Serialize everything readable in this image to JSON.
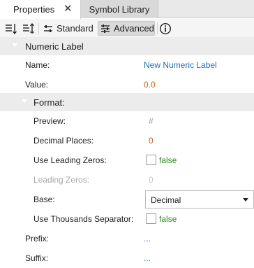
{
  "tabs": [
    {
      "label": "Properties",
      "close": "✕"
    },
    {
      "label": "Symbol Library"
    }
  ],
  "toolbar": {
    "sort_icon": "sort-descending-icon",
    "filter_icon": "sort-ascending-icon",
    "standard_label": "Standard",
    "advanced_label": "Advanced",
    "info_icon": "info-icon"
  },
  "section": {
    "title": "Numeric Label",
    "name_label": "Name:",
    "name_value": "New Numeric Label",
    "value_label": "Value:",
    "value_value": "0.0"
  },
  "format": {
    "title": "Format:",
    "preview_label": "Preview:",
    "preview_value": "#",
    "decimal_label": "Decimal Places:",
    "decimal_value": "0",
    "leading_zeros_use_label": "Use Leading Zeros:",
    "leading_zeros_use_value": "false",
    "leading_zeros_label": "Leading Zeros:",
    "leading_zeros_value": "0",
    "base_label": "Base:",
    "base_value": "Decimal",
    "thousands_label": "Use Thousands Separator:",
    "thousands_value": "false"
  },
  "prefix": {
    "label": "Prefix:",
    "value": "..."
  },
  "suffix": {
    "label": "Suffix:",
    "value": "..."
  },
  "colors": {
    "link": "#1f6fb6",
    "number": "#c8641e",
    "bool": "#2e8b1f"
  }
}
